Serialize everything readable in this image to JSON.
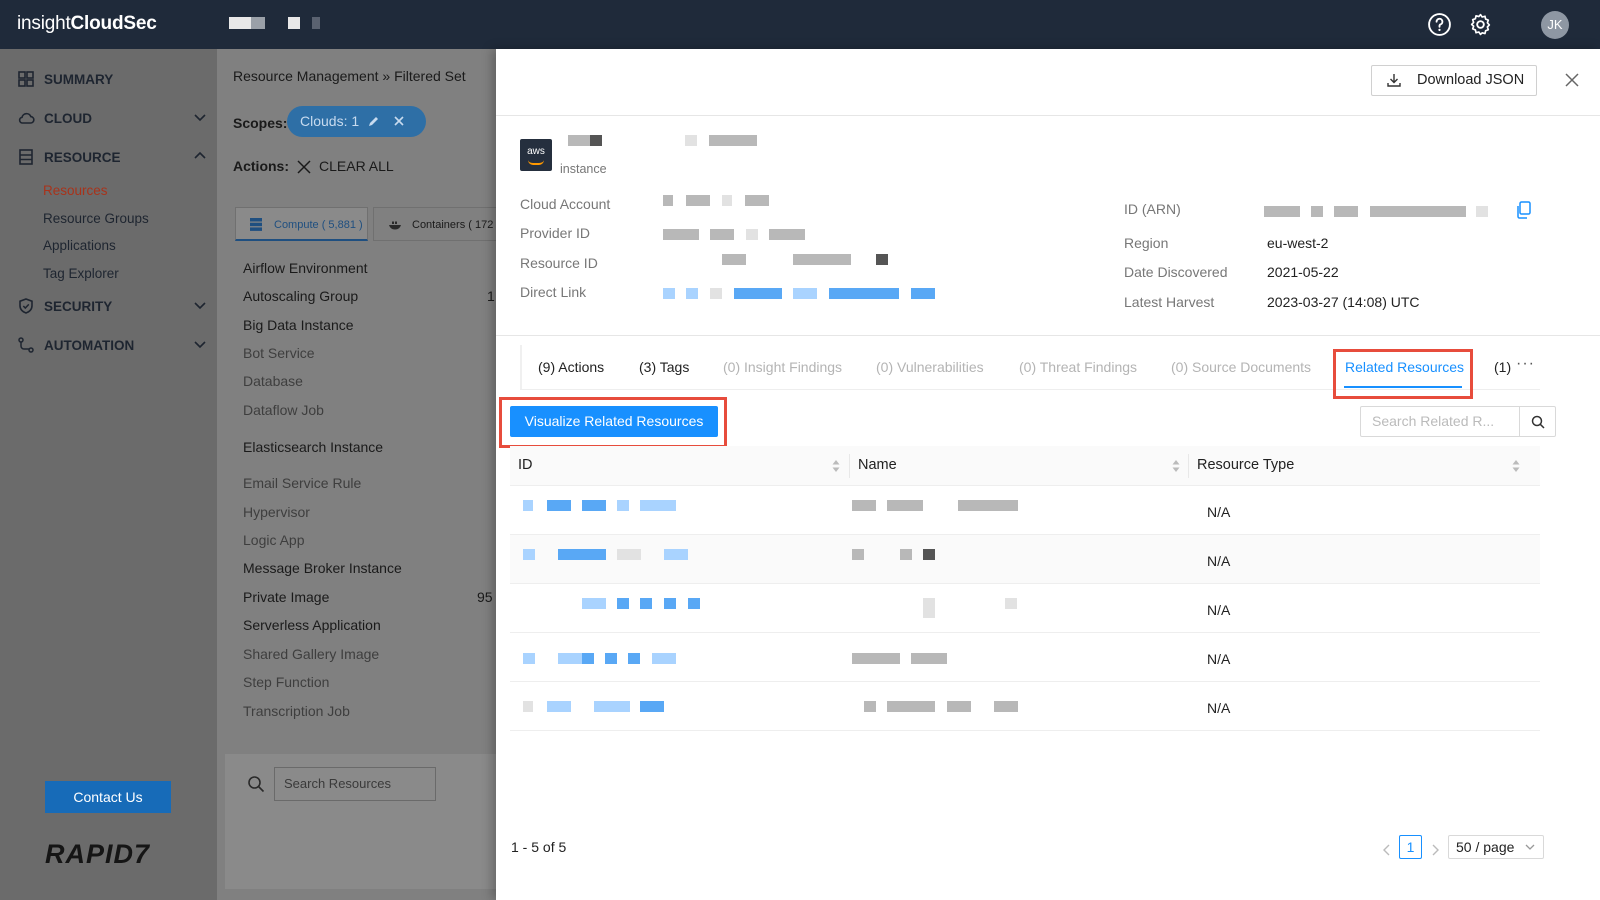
{
  "topbar": {
    "brand_light": "insight",
    "brand_bold": "CloudSec",
    "avatar_initials": "JK"
  },
  "nav": {
    "summary": "SUMMARY",
    "cloud": "CLOUD",
    "resource": "RESOURCE",
    "sub": [
      "Resources",
      "Resource Groups",
      "Applications",
      "Tag Explorer"
    ],
    "security": "SECURITY",
    "automation": "AUTOMATION",
    "contact": "Contact Us",
    "logo": "RAPID7"
  },
  "mid": {
    "breadcrumb": "Resource Management » Filtered Set",
    "scopes_label": "Scopes:",
    "scope_pill": "Clouds: 1",
    "actions_label": "Actions:",
    "clear_all": "CLEAR ALL",
    "tab_compute": "Compute ( 5,881 )",
    "tab_containers": "Containers ( 172",
    "resources": [
      "Airflow Environment",
      "Autoscaling Group",
      "Big Data Instance",
      "Bot Service",
      "Database",
      "Dataflow Job",
      "Elasticsearch Instance",
      "Email Service Rule",
      "Hypervisor",
      "Logic App",
      "Message Broker Instance",
      "Private Image",
      "Serverless Application",
      "Shared Gallery Image",
      "Step Function",
      "Transcription Job"
    ],
    "count_autoscaling": "1",
    "count_private_image": "95",
    "search_placeholder": "Search Resources"
  },
  "drawer": {
    "download_label": "Download JSON",
    "aws_badge": "aws",
    "instance_type": "instance",
    "labels": {
      "cloud_account": "Cloud Account",
      "provider_id": "Provider ID",
      "resource_id": "Resource ID",
      "direct_link": "Direct Link",
      "arn": "ID (ARN)",
      "region": "Region",
      "date_discovered": "Date Discovered",
      "latest_harvest": "Latest Harvest"
    },
    "values": {
      "region": "eu-west-2",
      "date_discovered": "2021-05-22",
      "latest_harvest": "2023-03-27 (14:08) UTC"
    },
    "tabs": [
      "(9) Actions",
      "(3) Tags",
      "(0) Insight Findings",
      "(0) Vulnerabilities",
      "(0) Threat Findings",
      "(0) Source Documents",
      "Related Resources",
      "(1)"
    ],
    "more": "···",
    "visualize_label": "Visualize Related Resources",
    "search_related_placeholder": "Search Related R...",
    "table": {
      "headers": [
        "ID",
        "Name",
        "Resource Type"
      ],
      "rows": [
        {
          "type": "N/A"
        },
        {
          "type": "N/A"
        },
        {
          "type": "N/A"
        },
        {
          "type": "N/A"
        },
        {
          "type": "N/A"
        }
      ]
    },
    "pagination": {
      "summary": "1 - 5 of 5",
      "current_page": "1",
      "page_size": "50 / page"
    }
  },
  "colors": {
    "topbar": "#1f2a3a",
    "accent": "#1890ff",
    "highlight": "#e74c3c",
    "active_nav": "#a8331b"
  }
}
